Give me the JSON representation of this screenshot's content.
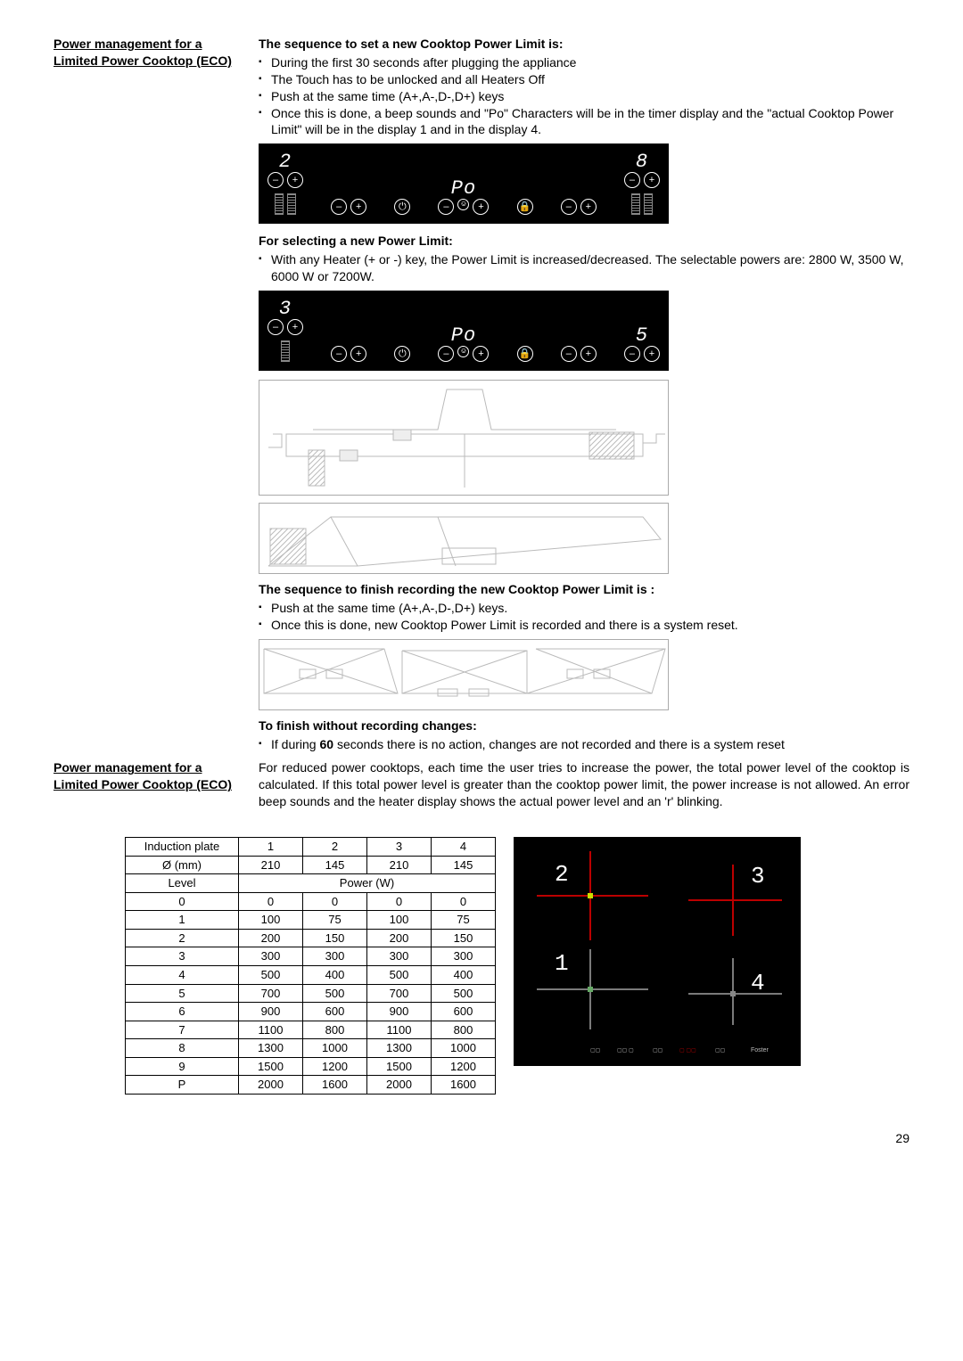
{
  "page_number": "29",
  "side_heading_1": "Power management for a Limited Power Cooktop (ECO)",
  "s1_heading": "The sequence to set a new Cooktop Power Limit is:",
  "s1_bullets": [
    "During the first 30 seconds after plugging the appliance",
    "The Touch has to be unlocked and all Heaters Off",
    "Push at the same time (A+,A-,D-,D+) keys",
    "Once this is done, a beep sounds and \"Po\" Characters will be in the timer display and the \"actual Cooktop Power Limit\" will be in the display 1 and in the display 4."
  ],
  "panel1": {
    "left": "2",
    "center": "Po",
    "right": "8"
  },
  "s2_heading": "For selecting a new Power Limit:",
  "s2_bullets": [
    "With any Heater (+ or -) key, the Power Limit is increased/decreased. The selectable powers are: 2800 W, 3500 W, 6000 W or 7200W."
  ],
  "panel2": {
    "left": "3",
    "center": "Po",
    "right": "5"
  },
  "s3_heading": "The sequence to finish recording the new Cooktop Power Limit is :",
  "s3_bullets": [
    "Push at the same time (A+,A-,D-,D+) keys.",
    "Once this is done, new Cooktop Power Limit is recorded and there is a system reset."
  ],
  "s4_heading": "To finish without recording changes:",
  "s4_bullets_pre": "If during ",
  "s4_bold": "60",
  "s4_bullets_post": " seconds there is no action, changes are not recorded and there is a system reset",
  "side_heading_2": "Power management for a Limited Power Cooktop (ECO)",
  "eco_para": "For reduced power cooktops, each time the user tries to increase the power, the total power level of the cooktop is calculated. If this total power level is greater than the cooktop power limit, the power increase is not allowed. An error beep sounds and the heater display shows the actual power level and an 'r' blinking.",
  "table": {
    "head_row1": [
      "Induction plate",
      "1",
      "2",
      "3",
      "4"
    ],
    "diam_label": "Ø (mm)",
    "diam": [
      "210",
      "145",
      "210",
      "145"
    ],
    "level_label": "Level",
    "power_label": "Power (W)",
    "rows": [
      [
        "0",
        "0",
        "0",
        "0",
        "0"
      ],
      [
        "1",
        "100",
        "75",
        "100",
        "75"
      ],
      [
        "2",
        "200",
        "150",
        "200",
        "150"
      ],
      [
        "3",
        "300",
        "300",
        "300",
        "300"
      ],
      [
        "4",
        "500",
        "400",
        "500",
        "400"
      ],
      [
        "5",
        "700",
        "500",
        "700",
        "500"
      ],
      [
        "6",
        "900",
        "600",
        "900",
        "600"
      ],
      [
        "7",
        "1100",
        "800",
        "1100",
        "800"
      ],
      [
        "8",
        "1300",
        "1000",
        "1300",
        "1000"
      ],
      [
        "9",
        "1500",
        "1200",
        "1500",
        "1200"
      ],
      [
        "P",
        "2000",
        "1600",
        "2000",
        "1600"
      ]
    ]
  },
  "zones": {
    "z1": "1",
    "z2": "2",
    "z3": "3",
    "z4": "4"
  }
}
